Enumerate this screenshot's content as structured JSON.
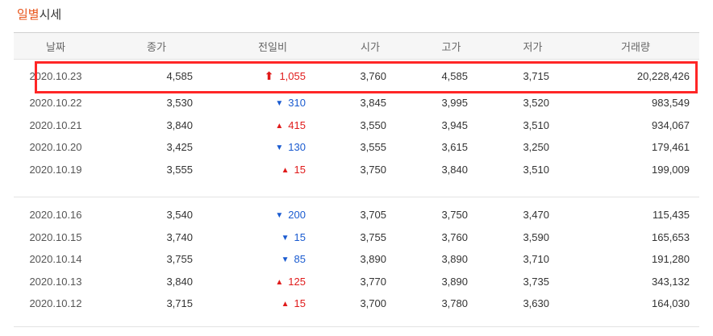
{
  "title": {
    "accent": "일별",
    "rest": "시세"
  },
  "headers": [
    "날짜",
    "종가",
    "전일비",
    "시가",
    "고가",
    "저가",
    "거래량"
  ],
  "group1": [
    {
      "date": "2020.10.23",
      "close": "4,585",
      "dir": "up-arrow",
      "diff": "1,055",
      "open": "3,760",
      "high": "4,585",
      "low": "3,715",
      "volume": "20,228,426"
    },
    {
      "date": "2020.10.22",
      "close": "3,530",
      "dir": "down",
      "diff": "310",
      "open": "3,845",
      "high": "3,995",
      "low": "3,520",
      "volume": "983,549"
    },
    {
      "date": "2020.10.21",
      "close": "3,840",
      "dir": "up",
      "diff": "415",
      "open": "3,550",
      "high": "3,945",
      "low": "3,510",
      "volume": "934,067"
    },
    {
      "date": "2020.10.20",
      "close": "3,425",
      "dir": "down",
      "diff": "130",
      "open": "3,555",
      "high": "3,615",
      "low": "3,250",
      "volume": "179,461"
    },
    {
      "date": "2020.10.19",
      "close": "3,555",
      "dir": "up",
      "diff": "15",
      "open": "3,750",
      "high": "3,840",
      "low": "3,510",
      "volume": "199,009"
    }
  ],
  "group2": [
    {
      "date": "2020.10.16",
      "close": "3,540",
      "dir": "down",
      "diff": "200",
      "open": "3,705",
      "high": "3,750",
      "low": "3,470",
      "volume": "115,435"
    },
    {
      "date": "2020.10.15",
      "close": "3,740",
      "dir": "down",
      "diff": "15",
      "open": "3,755",
      "high": "3,760",
      "low": "3,590",
      "volume": "165,653"
    },
    {
      "date": "2020.10.14",
      "close": "3,755",
      "dir": "down",
      "diff": "85",
      "open": "3,890",
      "high": "3,890",
      "low": "3,710",
      "volume": "191,280"
    },
    {
      "date": "2020.10.13",
      "close": "3,840",
      "dir": "up",
      "diff": "125",
      "open": "3,770",
      "high": "3,890",
      "low": "3,735",
      "volume": "343,132"
    },
    {
      "date": "2020.10.12",
      "close": "3,715",
      "dir": "up",
      "diff": "15",
      "open": "3,700",
      "high": "3,780",
      "low": "3,630",
      "volume": "164,030"
    }
  ],
  "colors": {
    "up": "#e01b1b",
    "down": "#1a5bd0",
    "highlight": "#ff2626",
    "accent": "#e8541a"
  }
}
